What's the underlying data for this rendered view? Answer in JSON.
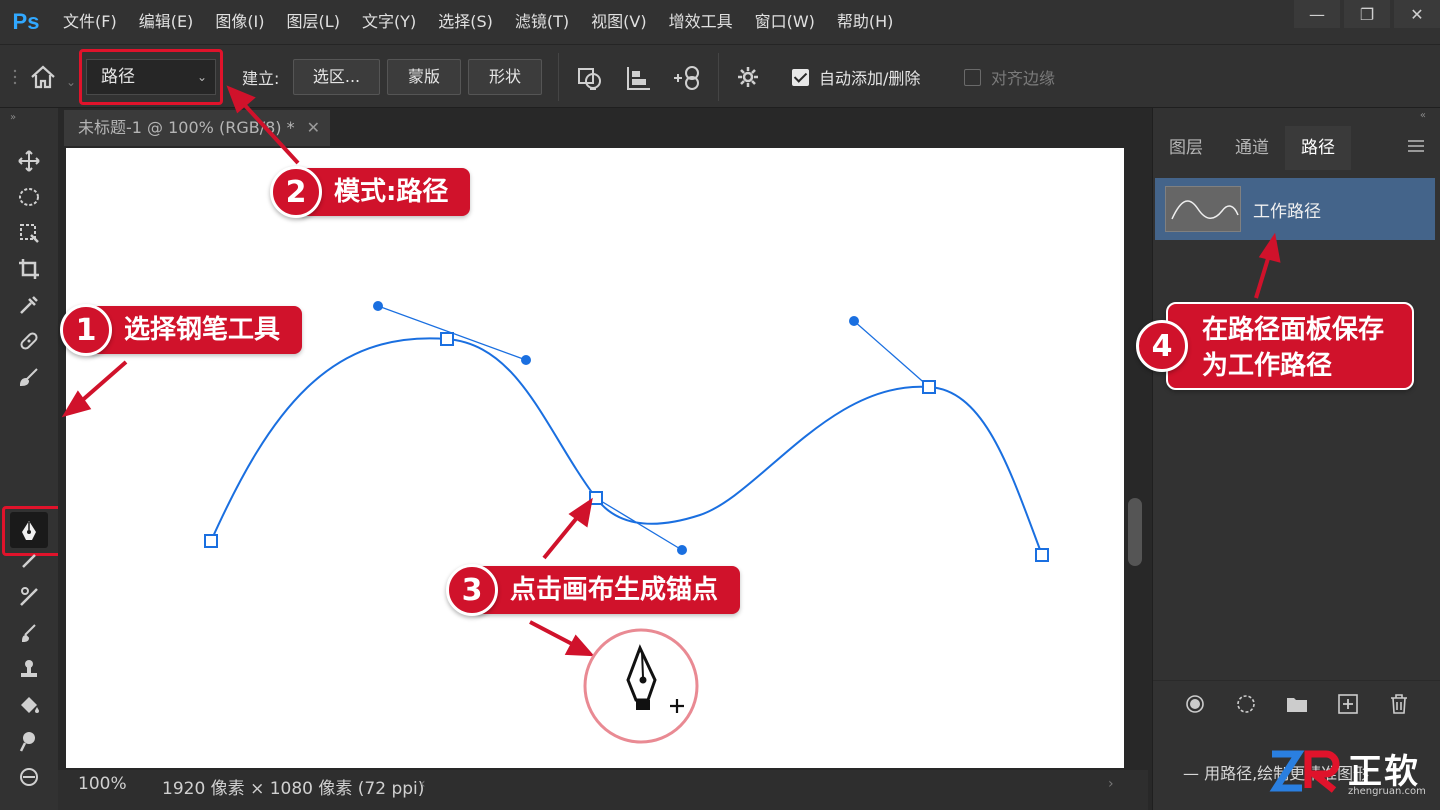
{
  "app": {
    "logo": "Ps",
    "accent": "#31a8ff"
  },
  "menu": [
    "文件(F)",
    "编辑(E)",
    "图像(I)",
    "图层(L)",
    "文字(Y)",
    "选择(S)",
    "滤镜(T)",
    "视图(V)",
    "增效工具",
    "窗口(W)",
    "帮助(H)"
  ],
  "window_controls": [
    "minimize-icon",
    "restore-icon",
    "close-icon"
  ],
  "options": {
    "mode_value": "路径",
    "make_label": "建立:",
    "btn_selection": "选区...",
    "btn_mask": "蒙版",
    "btn_shape": "形状",
    "auto_add_label": "自动添加/删除",
    "auto_add_checked": true,
    "align_edges_label": "对齐边缘",
    "align_edges_checked": false
  },
  "document": {
    "tab_title": "未标题-1 @ 100% (RGB/8) *",
    "close": "✕"
  },
  "status": {
    "zoom": "100%",
    "size": "1920 像素 × 1080 像素 (72 ppi)"
  },
  "panel": {
    "tabs": [
      "图层",
      "通道",
      "路径"
    ],
    "active_tab": "路径",
    "path_item": "工作路径",
    "hint": "— 用路径,绘制更精准图形"
  },
  "callouts": {
    "c1": {
      "num": "1",
      "text": "选择钢笔工具"
    },
    "c2": {
      "num": "2",
      "text": "模式:路径"
    },
    "c3": {
      "num": "3",
      "text": "点击画布生成锚点"
    },
    "c4": {
      "num": "4",
      "line1": "在路径面板保存",
      "line2": "为工作路径"
    }
  },
  "colors": {
    "highlight": "#e0132b",
    "callout": "#d0122b",
    "path": "#1a6fe0",
    "selected_row": "#44648a"
  },
  "watermark": {
    "text": "正软",
    "url": "zhengruan.com"
  }
}
